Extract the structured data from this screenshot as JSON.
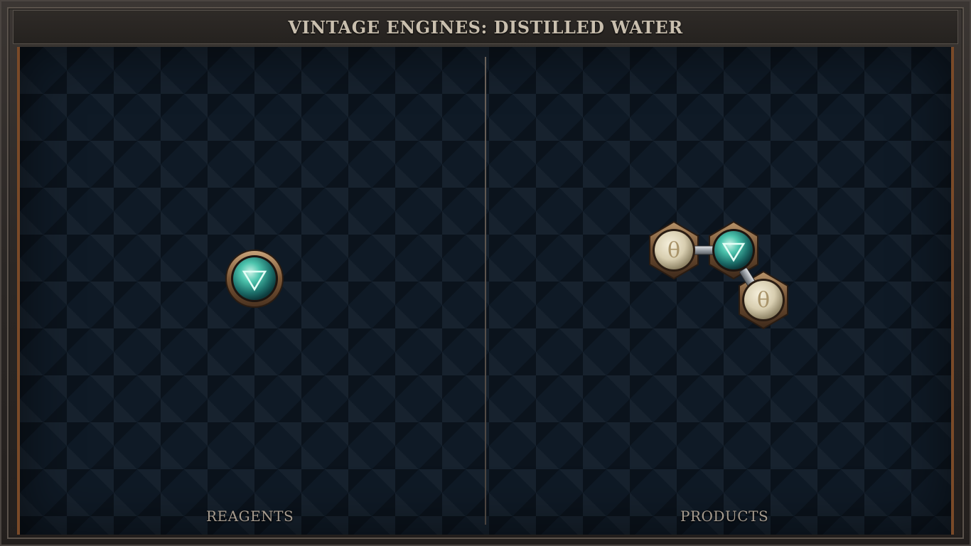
{
  "window": {
    "title": "VINTAGE ENGINES: DISTILLED WATER"
  },
  "panels": {
    "reagents": {
      "label": "REAGENTS",
      "atoms": [
        {
          "element": "water",
          "symbol": "▽",
          "icon": "water-triangle-icon"
        }
      ]
    },
    "products": {
      "label": "PRODUCTS",
      "atoms": [
        {
          "element": "salt",
          "symbol": "θ",
          "icon": "salt-symbol-icon"
        },
        {
          "element": "water",
          "symbol": "▽",
          "icon": "water-triangle-icon"
        },
        {
          "element": "salt",
          "symbol": "θ",
          "icon": "salt-symbol-icon"
        }
      ]
    }
  },
  "colors": {
    "board": "#0f1a26",
    "frame_accent": "#7a4a28",
    "water_atom": "#3fb3a0",
    "salt_atom": "#ddd3b8",
    "title_text": "#c9bfae"
  }
}
